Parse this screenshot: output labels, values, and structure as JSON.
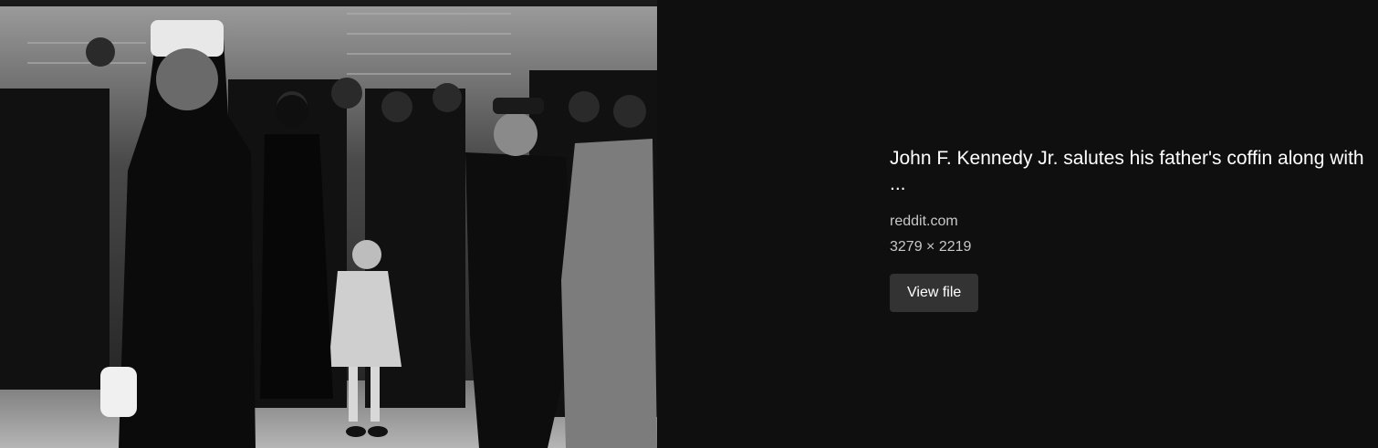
{
  "result": {
    "title": "John F. Kennedy Jr. salutes his father's coffin along with ...",
    "source": "reddit.com",
    "dimensions": "3279 × 2219",
    "view_file_label": "View file"
  }
}
